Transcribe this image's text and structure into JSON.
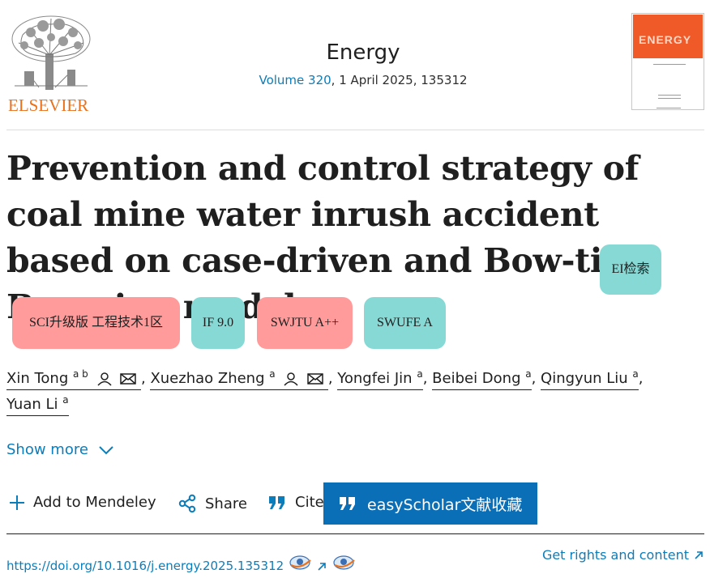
{
  "header": {
    "publisher": "ELSEVIER",
    "journal_name": "Energy",
    "volume_label": "Volume 320",
    "volume_rest": ", 1 April 2025, 135312",
    "cover_title": "ENERGY",
    "brand_orange": "#e9711c",
    "cover_color": "#f05a28"
  },
  "article": {
    "title": "Prevention and control strategy of coal mine water inrush accident based on case-driven and Bow-tie-Bayesian model",
    "tag_ei": "EI检索"
  },
  "badges": [
    {
      "label": "SCI升级版 工程技术1区",
      "color": "#ff9b9b"
    },
    {
      "label": "IF 9.0",
      "color": "#86d9d4"
    },
    {
      "label": "SWJTU A++",
      "color": "#ff9b9b"
    },
    {
      "label": "SWUFE A",
      "color": "#86d9d4"
    }
  ],
  "authors": [
    {
      "name": "Xin Tong",
      "aff": "a b",
      "icons": [
        "person-icon",
        "mail-icon"
      ]
    },
    {
      "name": "Xuezhao Zheng",
      "aff": "a",
      "icons": [
        "person-icon",
        "mail-icon"
      ]
    },
    {
      "name": "Yongfei Jin",
      "aff": "a",
      "icons": []
    },
    {
      "name": "Beibei Dong",
      "aff": "a",
      "icons": []
    },
    {
      "name": "Qingyun Liu",
      "aff": "a",
      "icons": []
    },
    {
      "name": "Yuan Li",
      "aff": "a",
      "icons": []
    }
  ],
  "show_more": "Show more",
  "toolbar": {
    "mendeley": "Add to Mendeley",
    "share": "Share",
    "cite": "Cite",
    "easyscholar": "easyScholar文献收藏"
  },
  "footer": {
    "doi": "https://doi.org/10.1016/j.energy.2025.135312",
    "rights": "Get rights and content"
  },
  "colors": {
    "link": "#0c7dbb",
    "easyscholar_bg": "#0a6fb6"
  }
}
